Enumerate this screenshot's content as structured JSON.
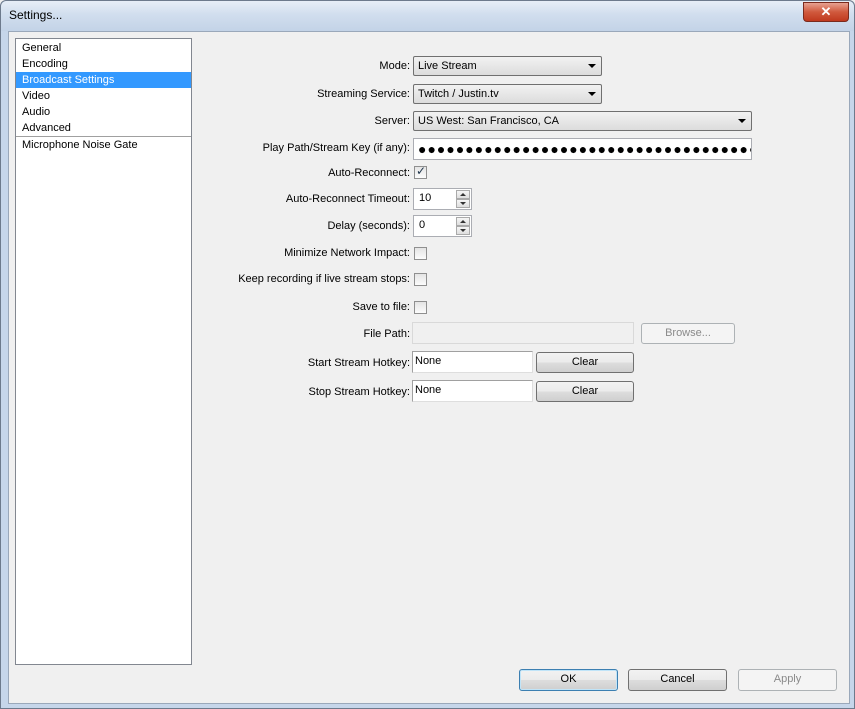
{
  "window": {
    "title": "Settings...",
    "close_glyph": "✕"
  },
  "nav": {
    "items": [
      "General",
      "Encoding",
      "Broadcast Settings",
      "Video",
      "Audio",
      "Advanced"
    ],
    "selected": "Broadcast Settings",
    "plugins": [
      "Microphone Noise Gate"
    ]
  },
  "form": {
    "mode_label": "Mode:",
    "mode_value": "Live Stream",
    "service_label": "Streaming Service:",
    "service_value": "Twitch / Justin.tv",
    "server_label": "Server:",
    "server_value": "US West: San Francisco, CA",
    "playpath_label": "Play Path/Stream Key (if any):",
    "playpath_value": "●●●●●●●●●●●●●●●●●●●●●●●●●●●●●●●●●●●●●●●●●",
    "autoreconnect_label": "Auto-Reconnect:",
    "autoreconnect_checked": true,
    "timeout_label": "Auto-Reconnect Timeout:",
    "timeout_value": "10",
    "delay_label": "Delay (seconds):",
    "delay_value": "0",
    "minimize_label": "Minimize Network Impact:",
    "minimize_checked": false,
    "keeprec_label": "Keep recording if live stream stops:",
    "keeprec_checked": false,
    "savefile_label": "Save to file:",
    "savefile_checked": false,
    "filepath_label": "File Path:",
    "filepath_value": "",
    "browse_label": "Browse...",
    "start_hotkey_label": "Start Stream Hotkey:",
    "start_hotkey_value": "None",
    "stop_hotkey_label": "Stop Stream Hotkey:",
    "stop_hotkey_value": "None",
    "clear_label": "Clear",
    "check_glyph": "✓"
  },
  "footer": {
    "ok": "OK",
    "cancel": "Cancel",
    "apply": "Apply"
  }
}
